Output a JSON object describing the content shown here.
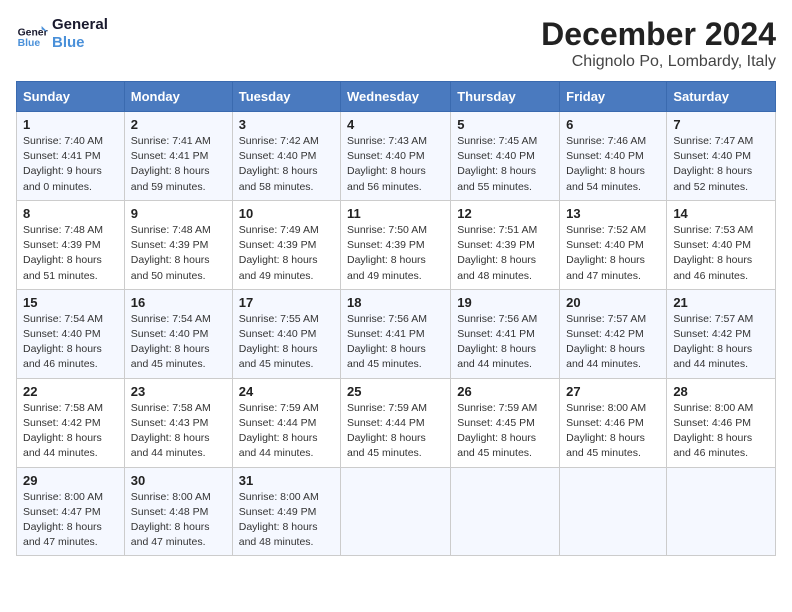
{
  "header": {
    "logo_line1": "General",
    "logo_line2": "Blue",
    "month": "December 2024",
    "location": "Chignolo Po, Lombardy, Italy"
  },
  "weekdays": [
    "Sunday",
    "Monday",
    "Tuesday",
    "Wednesday",
    "Thursday",
    "Friday",
    "Saturday"
  ],
  "weeks": [
    [
      {
        "day": 1,
        "sunrise": "7:40 AM",
        "sunset": "4:41 PM",
        "daylight": "9 hours and 0 minutes."
      },
      {
        "day": 2,
        "sunrise": "7:41 AM",
        "sunset": "4:41 PM",
        "daylight": "8 hours and 59 minutes."
      },
      {
        "day": 3,
        "sunrise": "7:42 AM",
        "sunset": "4:40 PM",
        "daylight": "8 hours and 58 minutes."
      },
      {
        "day": 4,
        "sunrise": "7:43 AM",
        "sunset": "4:40 PM",
        "daylight": "8 hours and 56 minutes."
      },
      {
        "day": 5,
        "sunrise": "7:45 AM",
        "sunset": "4:40 PM",
        "daylight": "8 hours and 55 minutes."
      },
      {
        "day": 6,
        "sunrise": "7:46 AM",
        "sunset": "4:40 PM",
        "daylight": "8 hours and 54 minutes."
      },
      {
        "day": 7,
        "sunrise": "7:47 AM",
        "sunset": "4:40 PM",
        "daylight": "8 hours and 52 minutes."
      }
    ],
    [
      {
        "day": 8,
        "sunrise": "7:48 AM",
        "sunset": "4:39 PM",
        "daylight": "8 hours and 51 minutes."
      },
      {
        "day": 9,
        "sunrise": "7:48 AM",
        "sunset": "4:39 PM",
        "daylight": "8 hours and 50 minutes."
      },
      {
        "day": 10,
        "sunrise": "7:49 AM",
        "sunset": "4:39 PM",
        "daylight": "8 hours and 49 minutes."
      },
      {
        "day": 11,
        "sunrise": "7:50 AM",
        "sunset": "4:39 PM",
        "daylight": "8 hours and 49 minutes."
      },
      {
        "day": 12,
        "sunrise": "7:51 AM",
        "sunset": "4:39 PM",
        "daylight": "8 hours and 48 minutes."
      },
      {
        "day": 13,
        "sunrise": "7:52 AM",
        "sunset": "4:40 PM",
        "daylight": "8 hours and 47 minutes."
      },
      {
        "day": 14,
        "sunrise": "7:53 AM",
        "sunset": "4:40 PM",
        "daylight": "8 hours and 46 minutes."
      }
    ],
    [
      {
        "day": 15,
        "sunrise": "7:54 AM",
        "sunset": "4:40 PM",
        "daylight": "8 hours and 46 minutes."
      },
      {
        "day": 16,
        "sunrise": "7:54 AM",
        "sunset": "4:40 PM",
        "daylight": "8 hours and 45 minutes."
      },
      {
        "day": 17,
        "sunrise": "7:55 AM",
        "sunset": "4:40 PM",
        "daylight": "8 hours and 45 minutes."
      },
      {
        "day": 18,
        "sunrise": "7:56 AM",
        "sunset": "4:41 PM",
        "daylight": "8 hours and 45 minutes."
      },
      {
        "day": 19,
        "sunrise": "7:56 AM",
        "sunset": "4:41 PM",
        "daylight": "8 hours and 44 minutes."
      },
      {
        "day": 20,
        "sunrise": "7:57 AM",
        "sunset": "4:42 PM",
        "daylight": "8 hours and 44 minutes."
      },
      {
        "day": 21,
        "sunrise": "7:57 AM",
        "sunset": "4:42 PM",
        "daylight": "8 hours and 44 minutes."
      }
    ],
    [
      {
        "day": 22,
        "sunrise": "7:58 AM",
        "sunset": "4:42 PM",
        "daylight": "8 hours and 44 minutes."
      },
      {
        "day": 23,
        "sunrise": "7:58 AM",
        "sunset": "4:43 PM",
        "daylight": "8 hours and 44 minutes."
      },
      {
        "day": 24,
        "sunrise": "7:59 AM",
        "sunset": "4:44 PM",
        "daylight": "8 hours and 44 minutes."
      },
      {
        "day": 25,
        "sunrise": "7:59 AM",
        "sunset": "4:44 PM",
        "daylight": "8 hours and 45 minutes."
      },
      {
        "day": 26,
        "sunrise": "7:59 AM",
        "sunset": "4:45 PM",
        "daylight": "8 hours and 45 minutes."
      },
      {
        "day": 27,
        "sunrise": "8:00 AM",
        "sunset": "4:46 PM",
        "daylight": "8 hours and 45 minutes."
      },
      {
        "day": 28,
        "sunrise": "8:00 AM",
        "sunset": "4:46 PM",
        "daylight": "8 hours and 46 minutes."
      }
    ],
    [
      {
        "day": 29,
        "sunrise": "8:00 AM",
        "sunset": "4:47 PM",
        "daylight": "8 hours and 47 minutes."
      },
      {
        "day": 30,
        "sunrise": "8:00 AM",
        "sunset": "4:48 PM",
        "daylight": "8 hours and 47 minutes."
      },
      {
        "day": 31,
        "sunrise": "8:00 AM",
        "sunset": "4:49 PM",
        "daylight": "8 hours and 48 minutes."
      },
      null,
      null,
      null,
      null
    ]
  ]
}
